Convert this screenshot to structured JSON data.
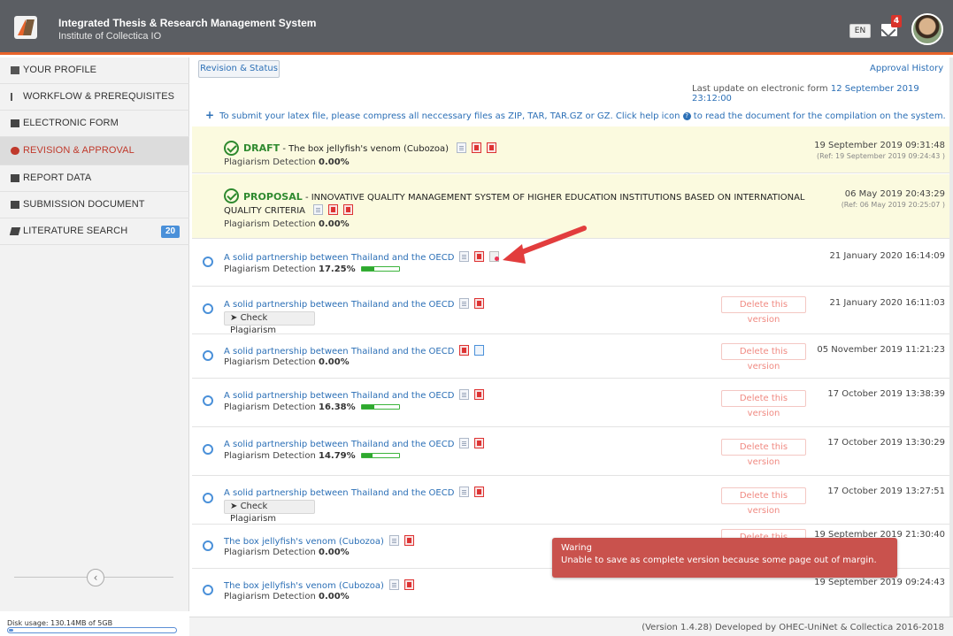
{
  "header": {
    "title": "Integrated Thesis & Research Management System",
    "subtitle": "Institute of Collectica IO",
    "lang": "EN",
    "mail_count": "4",
    "brand_color": "#e8632a"
  },
  "sidebar": {
    "items": [
      {
        "label": "YOUR PROFILE",
        "icon": "id-card-icon"
      },
      {
        "label": "WORKFLOW & PREREQUISITES",
        "icon": "sort-icon"
      },
      {
        "label": "ELECTRONIC FORM",
        "icon": "copy-icon"
      },
      {
        "label": "REVISION & APPROVAL",
        "icon": "cloud-upload-icon"
      },
      {
        "label": "REPORT DATA",
        "icon": "pencil-square-icon"
      },
      {
        "label": "SUBMISSION DOCUMENT",
        "icon": "file-icon"
      },
      {
        "label": "LITERATURE SEARCH",
        "icon": "book-icon",
        "badge": "20"
      }
    ],
    "active_index": 3,
    "disk_usage": "Disk usage: 130.14MB of 5GB",
    "disk_fraction": 0.026
  },
  "main": {
    "tab_label": "Revision & Status",
    "approval_history": "Approval History",
    "last_update_label": "Last update on electronic form",
    "last_update_value": "12 September 2019 23:12:00",
    "info_text": "To submit your latex file, please compress all neccessary files as ZIP, TAR, TAR.GZ or GZ. Click help icon",
    "info_text_after": "to read the document for the compilation on the system.",
    "approved": [
      {
        "stage": "DRAFT",
        "title": "The box jellyfish's venom (Cubozoa)",
        "plag_label": "Plagiarism Detection",
        "plag": "0.00%",
        "date": "19 September 2019 09:31:48",
        "ref": "(Ref: 19 September 2019 09:24:43 )"
      },
      {
        "stage": "PROPOSAL",
        "title_line1": "INNOVATIVE QUALITY MANAGEMENT SYSTEM OF HIGHER EDUCATION INSTITUTIONS BASED ON INTERNATIONAL",
        "title_line2": "QUALITY CRITERIA",
        "plag_label": "Plagiarism Detection",
        "plag": "0.00%",
        "date": "06 May 2019 20:43:29",
        "ref": "(Ref: 06 May 2019 20:25:07 )"
      }
    ],
    "versions": [
      {
        "title": "A solid partnership between Thailand and the OECD",
        "plag_label": "Plagiarism Detection",
        "plag": "17.25%",
        "plag_value": 17.25,
        "date": "21 January 2020 16:14:09"
      },
      {
        "title": "A solid partnership between Thailand and the OECD",
        "check_label": "Check Plagiarism",
        "delete": "Delete this version",
        "date": "21 January 2020 16:11:03"
      },
      {
        "title": "A solid partnership between Thailand and the OECD",
        "plag_label": "Plagiarism Detection",
        "plag": "0.00%",
        "delete": "Delete this version",
        "date": "05 November 2019 11:21:23"
      },
      {
        "title": "A solid partnership between Thailand and the OECD",
        "plag_label": "Plagiarism Detection",
        "plag": "16.38%",
        "plag_value": 16.38,
        "delete": "Delete this version",
        "date": "17 October 2019 13:38:39"
      },
      {
        "title": "A solid partnership between Thailand and the OECD",
        "plag_label": "Plagiarism Detection",
        "plag": "14.79%",
        "plag_value": 14.79,
        "delete": "Delete this version",
        "date": "17 October 2019 13:30:29"
      },
      {
        "title": "A solid partnership between Thailand and the OECD",
        "check_label": "Check Plagiarism",
        "delete": "Delete this version",
        "date": "17 October 2019 13:27:51"
      },
      {
        "title": "The box jellyfish's venom (Cubozoa)",
        "plag_label": "Plagiarism Detection",
        "plag": "0.00%",
        "delete": "Delete this version",
        "date": "19 September 2019 21:30:40"
      },
      {
        "title": "The box jellyfish's venom (Cubozoa)",
        "plag_label": "Plagiarism Detection",
        "plag": "0.00%",
        "date": "19 September 2019 09:24:43"
      }
    ]
  },
  "toast": {
    "title": "Waring",
    "message": "Unable to save as complete version because some page out of margin."
  },
  "footer": {
    "text": "(Version 1.4.28) Developed by OHEC-UniNet & Collectica 2016-2018"
  }
}
